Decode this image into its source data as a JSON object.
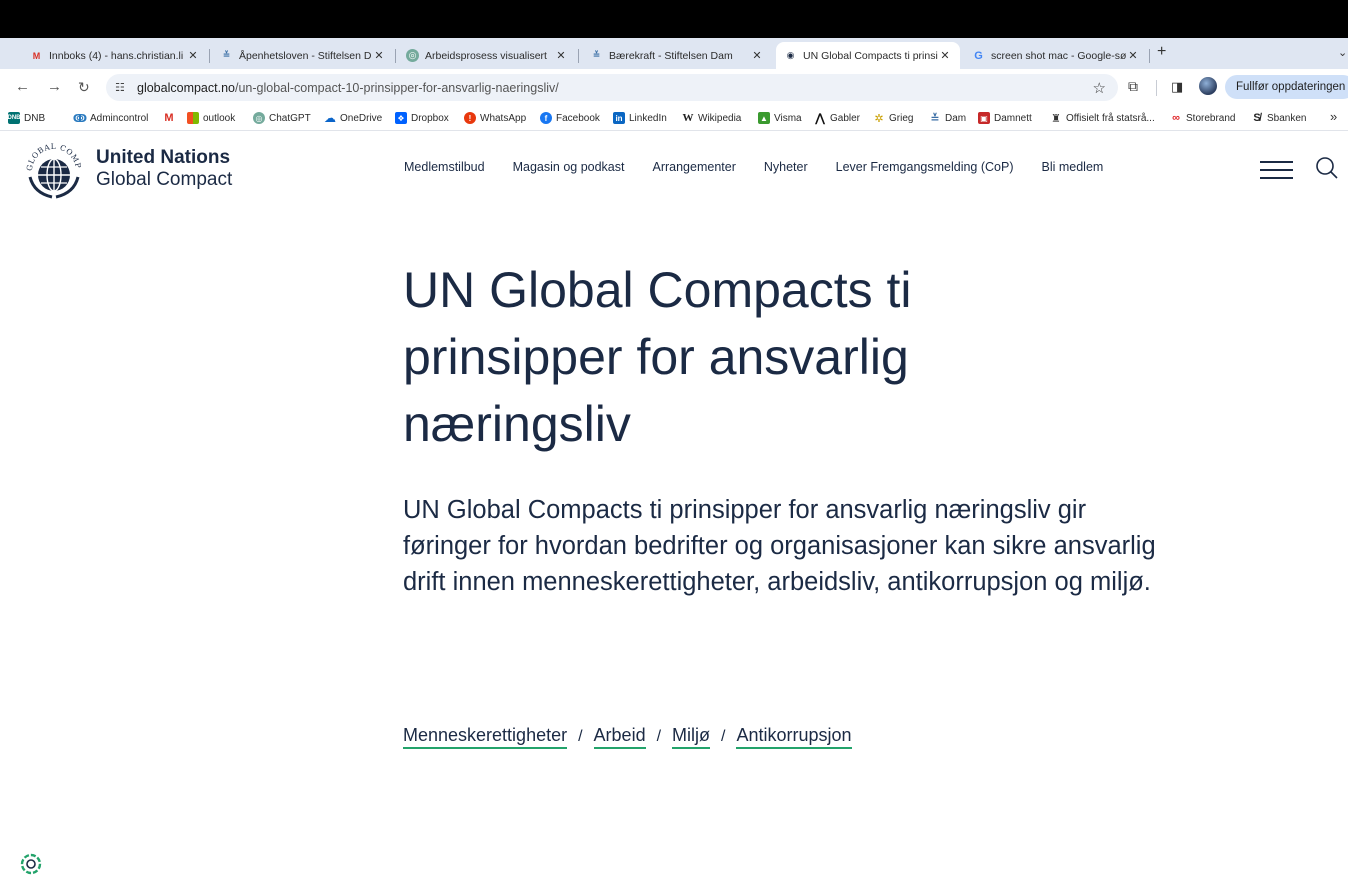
{
  "browser": {
    "tabs": [
      {
        "title": "Innboks (4) - hans.christian.li",
        "icon": "gmail-icon",
        "active": false
      },
      {
        "title": "Åpenhetsloven - Stiftelsen Da",
        "icon": "dam-icon",
        "active": false
      },
      {
        "title": "Arbeidsprosess visualisert",
        "icon": "chatgpt-icon",
        "active": false
      },
      {
        "title": "Bærekraft - Stiftelsen Dam",
        "icon": "dam-icon",
        "active": false
      },
      {
        "title": "UN Global Compacts ti prinsip",
        "icon": "un-globe-icon",
        "active": true
      },
      {
        "title": "screen shot mac - Google-sø",
        "icon": "google-icon",
        "active": false
      }
    ],
    "new_tab": "+",
    "url_host": "globalcompact.no",
    "url_path": "/un-global-compact-10-prinsipper-for-ansvarlig-naeringsliv/",
    "update_button": "Fullfør oppdateringen",
    "bookmarks": [
      {
        "label": "DNB",
        "icon": "dnb-icon"
      },
      {
        "label": "Admincontrol",
        "icon": "admincontrol-icon"
      },
      {
        "label": "",
        "icon": "gmail-icon"
      },
      {
        "label": "outlook",
        "icon": "microsoft-icon"
      },
      {
        "label": "ChatGPT",
        "icon": "chatgpt-icon"
      },
      {
        "label": "OneDrive",
        "icon": "onedrive-icon"
      },
      {
        "label": "Dropbox",
        "icon": "dropbox-icon"
      },
      {
        "label": "WhatsApp",
        "icon": "whatsapp-icon"
      },
      {
        "label": "Facebook",
        "icon": "facebook-icon"
      },
      {
        "label": "LinkedIn",
        "icon": "linkedin-icon"
      },
      {
        "label": "Wikipedia",
        "icon": "wikipedia-icon"
      },
      {
        "label": "Visma",
        "icon": "visma-icon"
      },
      {
        "label": "Gabler",
        "icon": "gabler-icon"
      },
      {
        "label": "Grieg",
        "icon": "grieg-icon"
      },
      {
        "label": "Dam",
        "icon": "dam-icon"
      },
      {
        "label": "Damnett",
        "icon": "damnett-icon"
      },
      {
        "label": "Offisielt frå statsrå...",
        "icon": "regjeringen-icon"
      },
      {
        "label": "Storebrand",
        "icon": "storebrand-icon"
      },
      {
        "label": "Sbanken",
        "icon": "sbanken-icon"
      }
    ],
    "bookmarks_more": "»"
  },
  "site": {
    "logo_line1": "United Nations",
    "logo_line2": "Global Compact",
    "logo_ring_text": "GLOBAL COMPACT",
    "nav": [
      "Medlemstilbud",
      "Magasin og podkast",
      "Arrangementer",
      "Nyheter",
      "Lever Fremgangsmelding (CoP)",
      "Bli medlem"
    ]
  },
  "hero": {
    "title": "UN Global Compacts ti prinsipper for ansvarlig næringsliv",
    "subtitle": "UN Global Compacts ti prinsipper for ansvarlig næringsliv gir føringer for hvordan bedrifter og organisasjoner kan sikre ansvarlig drift innen menneskerettigheter, arbeidsliv, antikorrupsjon og miljø.",
    "tags": [
      "Menneskerettigheter",
      "Arbeid",
      "Miljø",
      "Antikorrupsjon"
    ],
    "tag_separator": "/"
  },
  "colors": {
    "navy": "#1b2a44",
    "tag_underline": "#23a36b",
    "tabstrip": "#dfe6f2",
    "update_button": "#cfe0f8"
  }
}
